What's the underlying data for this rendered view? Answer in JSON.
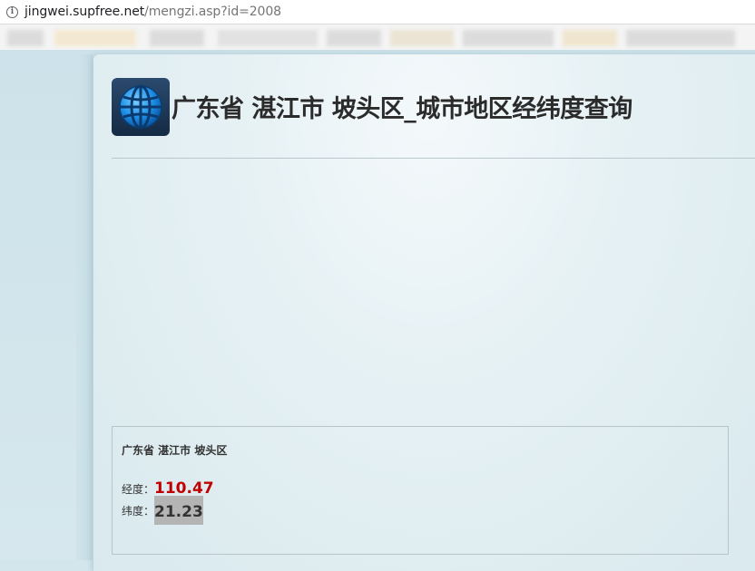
{
  "browser": {
    "url_host": "jingwei.supfree.net",
    "url_path": "/mengzi.asp?id=2008"
  },
  "page": {
    "title": "广东省 湛江市 坡头区_城市地区经纬度查询"
  },
  "result": {
    "location": "广东省 湛江市 坡头区",
    "longitude_label": "经度：",
    "longitude_value": "110.47",
    "latitude_label": "纬度：",
    "latitude_value": "21.23"
  },
  "colors": {
    "longitude_value": "#c00000",
    "latitude_highlight": "#b4b4b4",
    "logo_globe": "#1e90e8"
  },
  "icons": {
    "address_info": "info-icon",
    "logo": "globe-icon"
  }
}
